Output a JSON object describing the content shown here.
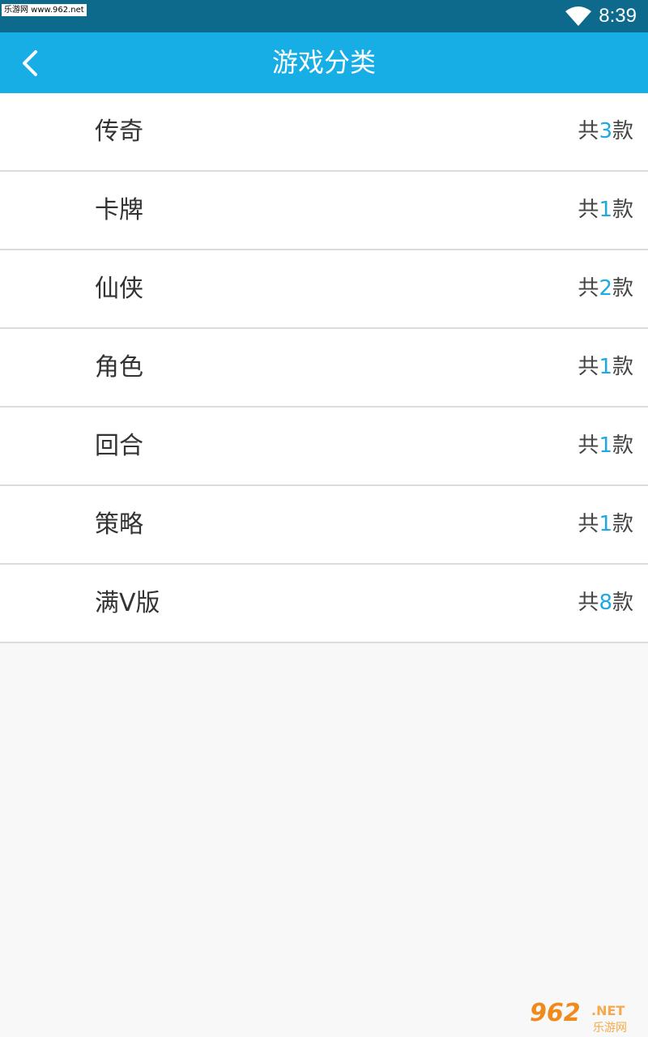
{
  "status_bar": {
    "watermark": "乐游网 www.962.net",
    "time": "8:39"
  },
  "header": {
    "title": "游戏分类"
  },
  "count_prefix": "共",
  "count_suffix": "款",
  "categories": [
    {
      "name": "传奇",
      "count": "3"
    },
    {
      "name": "卡牌",
      "count": "1"
    },
    {
      "name": "仙侠",
      "count": "2"
    },
    {
      "name": "角色",
      "count": "1"
    },
    {
      "name": "回合",
      "count": "1"
    },
    {
      "name": "策略",
      "count": "1"
    },
    {
      "name": "满V版",
      "count": "8"
    }
  ],
  "watermark_bottom": {
    "main": "962",
    "net": ".NET",
    "sub": "乐游网"
  },
  "icons": {
    "wifi": "wifi-icon",
    "back": "back-arrow-icon"
  },
  "colors": {
    "status_bar": "#0e6a8c",
    "app_bar": "#17aee6",
    "count_accent": "#1ea9e0",
    "background": "#f8f8f8"
  }
}
